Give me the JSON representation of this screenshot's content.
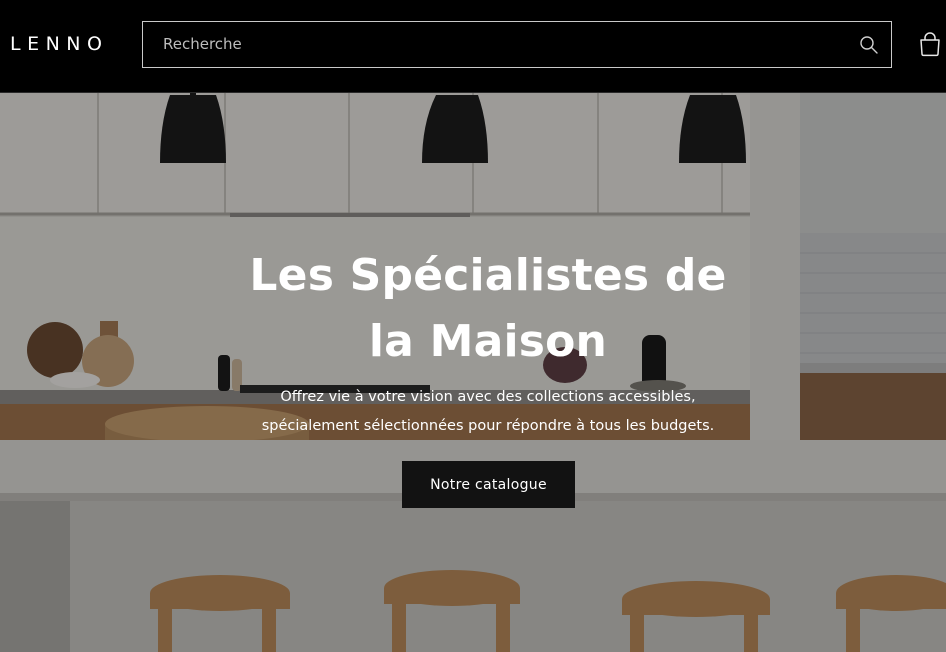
{
  "header": {
    "logo": "LENNO",
    "search": {
      "placeholder": "Recherche",
      "icon": "search-icon"
    },
    "cart": {
      "icon": "cart-icon"
    }
  },
  "hero": {
    "title_line1": "Les Spécialistes de",
    "title_line2": "la Maison",
    "text_line1": "Offrez vie à votre vision avec des collections accessibles,",
    "text_line2": "spécialement sélectionnées pour répondre à tous les budgets.",
    "button_label": "Notre catalogue"
  },
  "colors": {
    "header_bg": "#000000",
    "text": "#ffffff",
    "button_bg": "#121212"
  }
}
